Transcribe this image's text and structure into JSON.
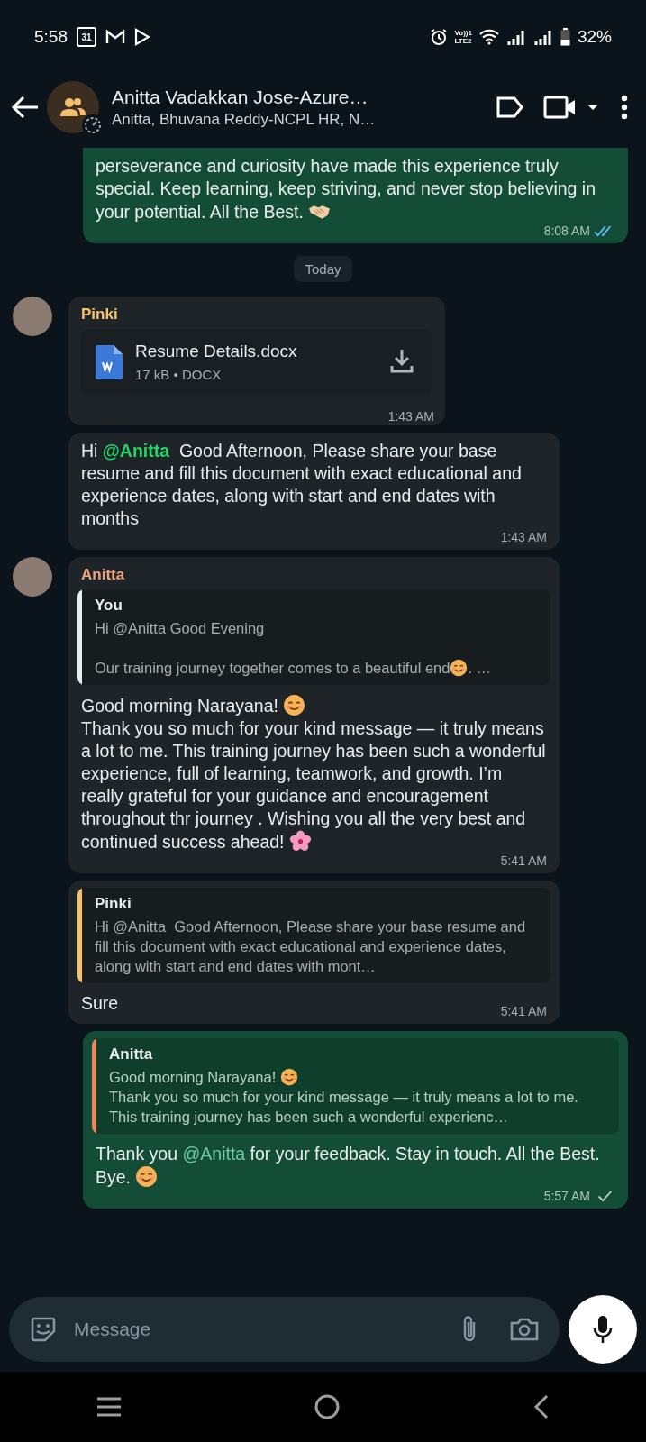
{
  "status_bar": {
    "time": "5:58",
    "calendar_day": "31",
    "network_label": [
      "Vo))1",
      "LTE2"
    ],
    "battery": "32%"
  },
  "header": {
    "title": "Anitta Vadakkan Jose-Azure…",
    "subtitle": "Anitta, Bhuvana Reddy-NCPL HR, N…"
  },
  "messages": [
    {
      "kind": "outgoing",
      "continued": true,
      "text": [
        {
          "kind": "text",
          "text": "perseverance and curiosity have made this experience truly special. Keep learning, keep striving, and never stop believing in your potential. All the Best. "
        },
        {
          "kind": "handshake"
        }
      ],
      "time": "8:08 AM",
      "read": true
    },
    {
      "kind": "date",
      "label": "Today"
    },
    {
      "kind": "file",
      "sender": "Pinki",
      "color": "#f7c46c",
      "file_name": "Resume Details.docx",
      "file_meta": "17 kB • DOCX",
      "time": "1:43 AM"
    },
    {
      "kind": "incoming",
      "text": [
        {
          "kind": "text",
          "text": "Hi "
        },
        {
          "kind": "mention",
          "text": "@Anitta"
        },
        {
          "kind": "text",
          "text": "  Good Afternoon, Please share your base resume and fill this document with exact educational and experience dates, along with start and end dates with months"
        }
      ],
      "time": "1:43 AM"
    },
    {
      "kind": "incoming",
      "sender": "Anitta",
      "color": "#f0a27e",
      "quote": {
        "author": "You",
        "color": "#e9edef",
        "text": [
          {
            "kind": "text",
            "text": "Hi @Anitta Good Evening\n\nOur training journey together comes to a beautiful end"
          },
          {
            "kind": "smile"
          },
          {
            "kind": "text",
            "text": ". …"
          }
        ]
      },
      "text": [
        {
          "kind": "text",
          "text": "Good morning Narayana! "
        },
        {
          "kind": "smile"
        },
        {
          "kind": "text",
          "text": "\nThank you so much for your kind message — it truly means a lot to me. This training journey has been such a wonderful experience, full of learning, teamwork, and growth. I’m really grateful for your guidance and encouragement throughout thr journey . Wishing you all the very best and continued success ahead! "
        },
        {
          "kind": "blossom"
        }
      ],
      "time": "5:41 AM"
    },
    {
      "kind": "incoming",
      "quote": {
        "author": "Pinki",
        "color": "#f7c46c",
        "text": [
          {
            "kind": "text",
            "text": "Hi @Anitta  Good Afternoon, Please share your base resume and fill this document with exact educational and experience dates, along with start and end dates with mont…"
          }
        ]
      },
      "text": [
        {
          "kind": "text",
          "text": "Sure"
        }
      ],
      "time": "5:41 AM"
    },
    {
      "kind": "outgoing",
      "continued": false,
      "quote": {
        "author": "Anitta",
        "color": "#f0875a",
        "text": [
          {
            "kind": "text",
            "text": "Good morning Narayana! "
          },
          {
            "kind": "smile"
          },
          {
            "kind": "text",
            "text": "\nThank you so much for your kind message — it truly means a lot to me. This training journey has been such a wonderful experienc…"
          }
        ]
      },
      "text": [
        {
          "kind": "text",
          "text": "Thank you "
        },
        {
          "kind": "mention",
          "text": "@Anitta"
        },
        {
          "kind": "text",
          "text": " for your feedback. Stay in touch. All the Best. Bye. "
        },
        {
          "kind": "smile"
        }
      ],
      "time": "5:57 AM",
      "read": false
    }
  ],
  "composer": {
    "placeholder": "Message"
  }
}
